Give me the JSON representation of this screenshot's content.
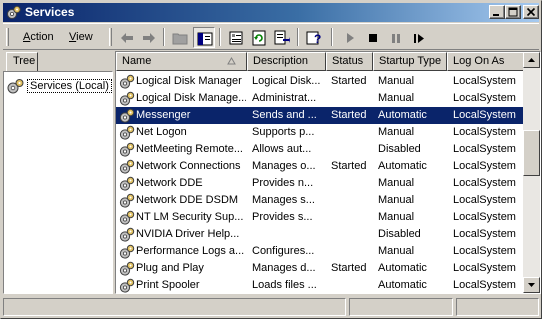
{
  "window": {
    "title": "Services",
    "title_icon": "services-gear-icon",
    "caption_buttons": [
      "minimize",
      "maximize",
      "close"
    ]
  },
  "menu": {
    "action": "Action",
    "action_accel": "A",
    "view": "View",
    "view_accel": "V"
  },
  "toolbar": {
    "buttons": [
      "back",
      "forward",
      "up-folder",
      "show-hide-console-tree",
      "properties",
      "refresh",
      "export-list",
      "help",
      "start-service",
      "stop-service",
      "pause-service",
      "restart-service"
    ]
  },
  "tree": {
    "tab_label": "Tree",
    "root_label": "Services (Local)"
  },
  "list": {
    "columns": [
      "Name",
      "Description",
      "Status",
      "Startup Type",
      "Log On As"
    ],
    "sorted_column": "Name",
    "rows": [
      {
        "name": "Logical Disk Manager",
        "description": "Logical Disk...",
        "status": "Started",
        "startup": "Manual",
        "logon": "LocalSystem",
        "selected": false
      },
      {
        "name": "Logical Disk Manage...",
        "description": "Administrat...",
        "status": "",
        "startup": "Manual",
        "logon": "LocalSystem",
        "selected": false
      },
      {
        "name": "Messenger",
        "description": "Sends and ...",
        "status": "Started",
        "startup": "Automatic",
        "logon": "LocalSystem",
        "selected": true
      },
      {
        "name": "Net Logon",
        "description": "Supports p...",
        "status": "",
        "startup": "Manual",
        "logon": "LocalSystem",
        "selected": false
      },
      {
        "name": "NetMeeting Remote...",
        "description": "Allows aut...",
        "status": "",
        "startup": "Disabled",
        "logon": "LocalSystem",
        "selected": false
      },
      {
        "name": "Network Connections",
        "description": "Manages o...",
        "status": "Started",
        "startup": "Automatic",
        "logon": "LocalSystem",
        "selected": false
      },
      {
        "name": "Network DDE",
        "description": "Provides n...",
        "status": "",
        "startup": "Manual",
        "logon": "LocalSystem",
        "selected": false
      },
      {
        "name": "Network DDE DSDM",
        "description": "Manages s...",
        "status": "",
        "startup": "Manual",
        "logon": "LocalSystem",
        "selected": false
      },
      {
        "name": "NT LM Security Sup...",
        "description": "Provides s...",
        "status": "",
        "startup": "Manual",
        "logon": "LocalSystem",
        "selected": false
      },
      {
        "name": "NVIDIA Driver Help...",
        "description": "",
        "status": "",
        "startup": "Disabled",
        "logon": "LocalSystem",
        "selected": false
      },
      {
        "name": "Performance Logs a...",
        "description": "Configures...",
        "status": "",
        "startup": "Manual",
        "logon": "LocalSystem",
        "selected": false
      },
      {
        "name": "Plug and Play",
        "description": "Manages d...",
        "status": "Started",
        "startup": "Automatic",
        "logon": "LocalSystem",
        "selected": false
      },
      {
        "name": "Print Spooler",
        "description": "Loads files ...",
        "status": "",
        "startup": "Automatic",
        "logon": "LocalSystem",
        "selected": false
      }
    ]
  },
  "colors": {
    "title_active_start": "#0a246a",
    "title_active_end": "#a6caf0",
    "selection": "#0a246a",
    "face": "#d4d0c8"
  }
}
